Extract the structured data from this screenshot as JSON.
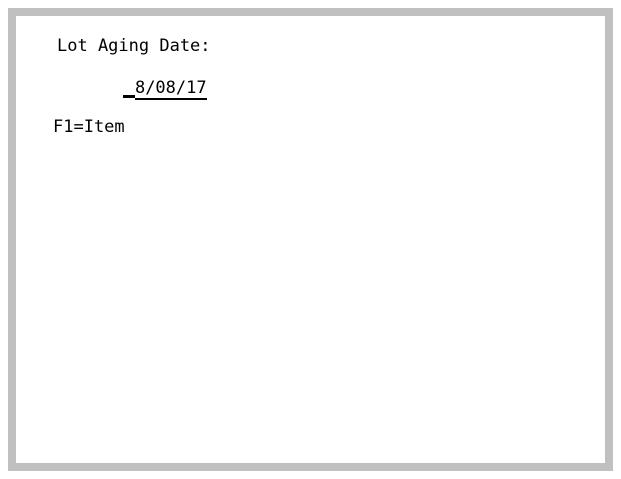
{
  "screen": {
    "field_label": "Lot Aging Date:",
    "field_value": "8/08/17",
    "function_keys": [
      {
        "label": "F1=Item"
      }
    ]
  },
  "colors": {
    "background": "#ffffff",
    "border": "#c0c0c0",
    "text": "#000000"
  }
}
